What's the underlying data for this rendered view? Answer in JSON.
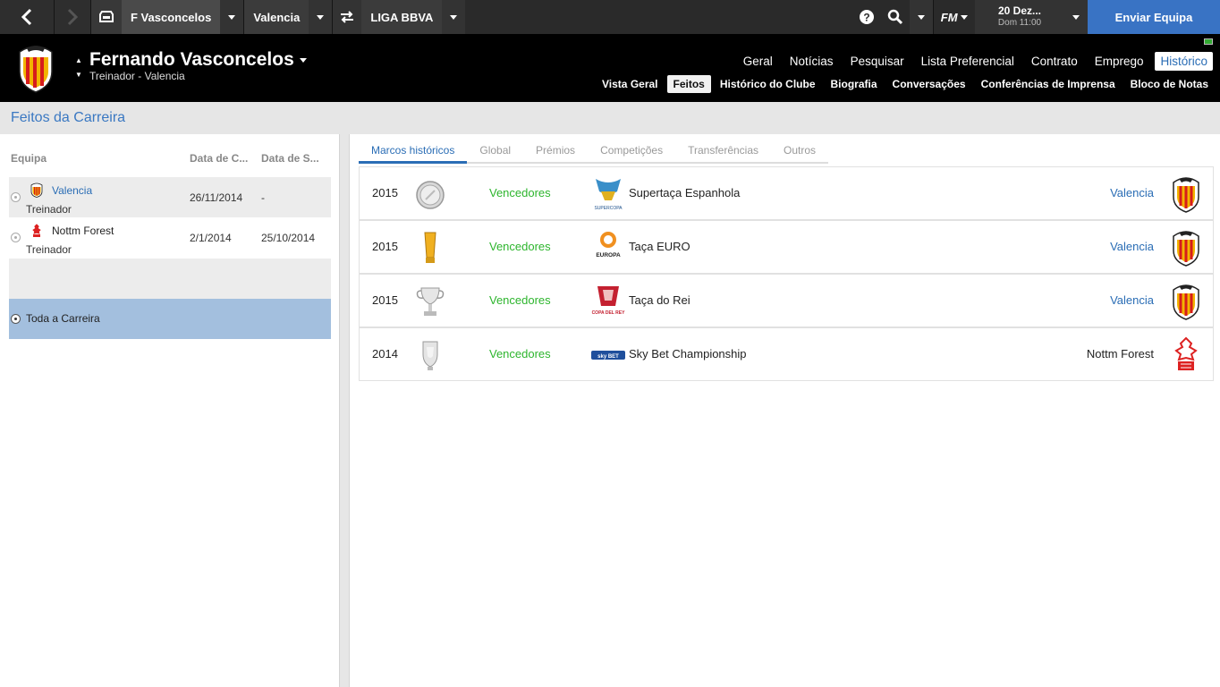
{
  "topbar": {
    "crumbs": [
      "F Vasconcelos",
      "Valencia",
      "LIGA BBVA"
    ],
    "logo_label": "FM",
    "date_line1": "20 Dez...",
    "date_line2": "Dom 11:00",
    "continue_label": "Enviar Equipa"
  },
  "header": {
    "name": "Fernando Vasconcelos",
    "subtitle": "Treinador - Valencia",
    "nav_main": [
      "Geral",
      "Notícias",
      "Pesquisar",
      "Lista Preferencial",
      "Contrato",
      "Emprego",
      "Histórico"
    ],
    "nav_main_selected": "Histórico",
    "nav_sub": [
      "Vista Geral",
      "Feitos",
      "Histórico do Clube",
      "Biografia",
      "Conversações",
      "Conferências de Imprensa",
      "Bloco de Notas"
    ],
    "nav_sub_selected": "Feitos"
  },
  "page": {
    "title": "Feitos da Carreira"
  },
  "career": {
    "columns": [
      "Equipa",
      "Data de C...",
      "Data de S..."
    ],
    "rows": [
      {
        "team": "Valencia",
        "role": "Treinador",
        "start": "26/11/2014",
        "end": "-"
      },
      {
        "team": "Nottm Forest",
        "role": "Treinador",
        "start": "2/1/2014",
        "end": "25/10/2014"
      }
    ],
    "whole_career": "Toda a Carreira"
  },
  "achievements": {
    "tabs": [
      "Marcos históricos",
      "Global",
      "Prémios",
      "Competições",
      "Transferências",
      "Outros"
    ],
    "tab_selected": "Marcos históricos",
    "items": [
      {
        "year": "2015",
        "result": "Vencedores",
        "competition": "Supertaça Espanhola",
        "logo_text": "SUPERCOPA",
        "club": "Valencia",
        "trophy": "supercopa-trophy-icon"
      },
      {
        "year": "2015",
        "result": "Vencedores",
        "competition": "Taça EURO",
        "logo_text": "EUROPA",
        "club": "Valencia",
        "trophy": "europa-trophy-icon"
      },
      {
        "year": "2015",
        "result": "Vencedores",
        "competition": "Taça do Rei",
        "logo_text": "COPA DEL REY",
        "club": "Valencia",
        "trophy": "copa-del-rey-trophy-icon"
      },
      {
        "year": "2014",
        "result": "Vencedores",
        "competition": "Sky Bet Championship",
        "logo_text": "sky BET",
        "club": "Nottm Forest",
        "trophy": "championship-trophy-icon"
      }
    ]
  },
  "colors": {
    "accent": "#2a6db5",
    "winner": "#2db52d",
    "continue_button": "#3973c4",
    "selected_row": "#a3bfde"
  }
}
